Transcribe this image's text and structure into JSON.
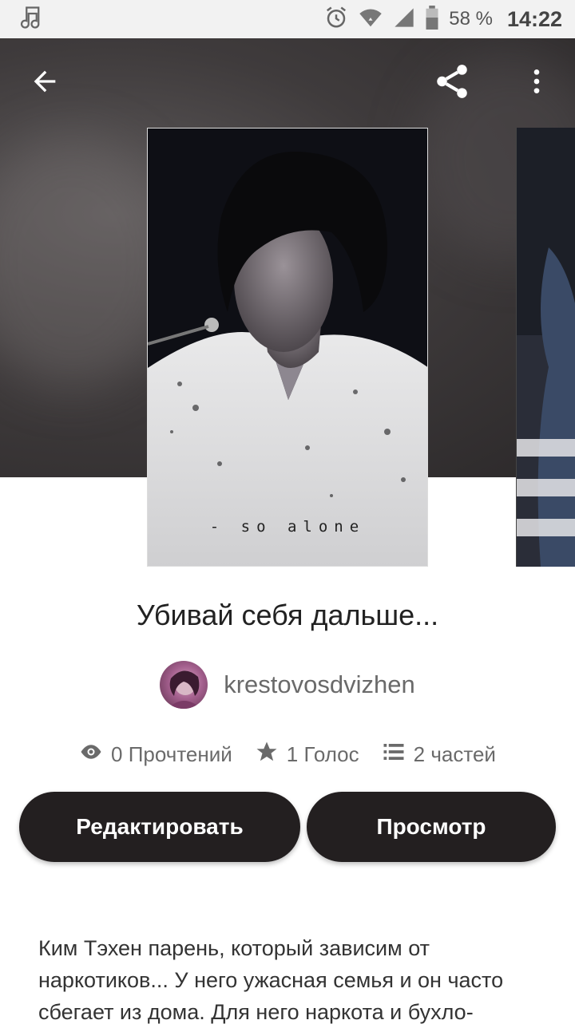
{
  "status_bar": {
    "battery_percent": "58 %",
    "time": "14:22",
    "icons": [
      "music-note-icon",
      "alarm-icon",
      "wifi-icon",
      "signal-icon",
      "battery-icon"
    ]
  },
  "toolbar": {
    "back_icon": "arrow-back-icon",
    "share_icon": "share-icon",
    "more_icon": "more-vert-icon"
  },
  "cover": {
    "caption": "- so alone"
  },
  "story": {
    "title": "Убивай себя дальше...",
    "author": "krestovosdvizhen"
  },
  "stats": {
    "reads": "0 Прочтений",
    "votes": "1 Голос",
    "parts": "2 частей"
  },
  "actions": {
    "edit_label": "Редактировать",
    "view_label": "Просмотр"
  },
  "description": "Ким Тэхен парень, который зависим от наркотиков... У него ужасная семья и он часто сбегает из дома. Для него наркота и бухло-",
  "colors": {
    "button_bg": "#231f20",
    "hero_bg": "#3f3b3c",
    "status_bar_bg": "#f2f2f2"
  }
}
